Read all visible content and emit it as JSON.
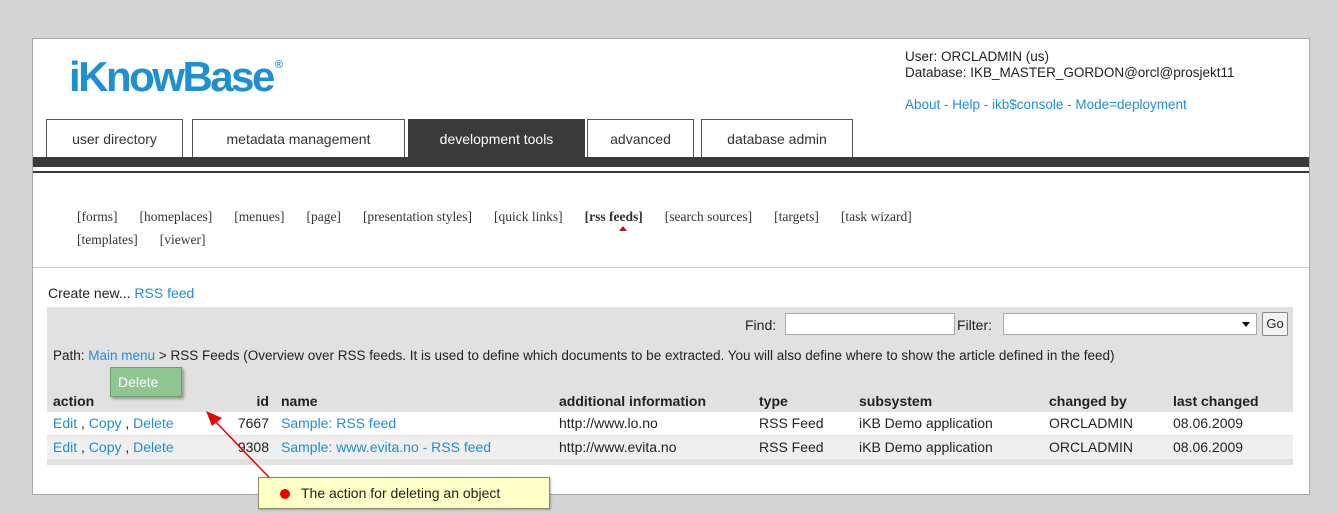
{
  "logo": {
    "text": "iKnowBase",
    "reg": "®"
  },
  "user": {
    "line1": "User: ORCLADMIN (us)",
    "line2": "Database: IKB_MASTER_GORDON@orcl@prosjekt11"
  },
  "toplinks": [
    {
      "label": "About"
    },
    {
      "label": "Help"
    },
    {
      "label": "ikb$console"
    },
    {
      "label": "Mode=deployment"
    }
  ],
  "tabs": [
    {
      "label": "user directory"
    },
    {
      "label": "metadata management"
    },
    {
      "label": "development tools",
      "active": true
    },
    {
      "label": "advanced"
    },
    {
      "label": "database admin"
    }
  ],
  "subnav": [
    {
      "label": "[forms]"
    },
    {
      "label": "[homeplaces]"
    },
    {
      "label": "[menues]"
    },
    {
      "label": "[page]"
    },
    {
      "label": "[presentation styles]"
    },
    {
      "label": "[quick links]"
    },
    {
      "label": "[rss feeds]",
      "active": true
    },
    {
      "label": "[search sources]"
    },
    {
      "label": "[targets]"
    },
    {
      "label": "[task wizard]"
    },
    {
      "label": "[templates]"
    },
    {
      "label": "[viewer]"
    }
  ],
  "create_new": {
    "prefix": "Create new... ",
    "link": "RSS feed"
  },
  "search": {
    "find_label": "Find:",
    "find_value": "",
    "filter_label": "Filter:",
    "filter_value": "",
    "go_label": "Go"
  },
  "path": {
    "prefix": "Path: ",
    "link": "Main menu",
    "rest": " > RSS Feeds (Overview over RSS feeds. It is used to define which documents to be extracted. You will also define where to show the article defined in the feed)"
  },
  "table": {
    "headers": [
      "action",
      "id",
      "name",
      "additional information",
      "type",
      "subsystem",
      "changed by",
      "last changed"
    ],
    "rows": [
      {
        "edit": "Edit",
        "copy": "Copy",
        "delete": "Delete",
        "id": "7667",
        "name": "Sample: RSS feed",
        "info": "http://www.lo.no",
        "type": "RSS Feed",
        "subsystem": "iKB Demo application",
        "changed_by": "ORCLADMIN",
        "last_changed": "08.06.2009"
      },
      {
        "edit": "Edit",
        "copy": "Copy",
        "delete": "Delete",
        "id": "9308",
        "name": "Sample: www.evita.no - RSS feed",
        "info": "http://www.evita.no",
        "type": "RSS Feed",
        "subsystem": "iKB Demo application",
        "changed_by": "ORCLADMIN",
        "last_changed": "08.06.2009"
      }
    ]
  },
  "annotation": {
    "highlight": "Delete",
    "callout": "The action for deleting an object"
  },
  "colors": {
    "accent": "#1e8fd3",
    "dark_bar": "#3a3a3a",
    "highlight": "#8fc591",
    "callout_bg": "#ffffc8",
    "marker": "#e00000"
  }
}
